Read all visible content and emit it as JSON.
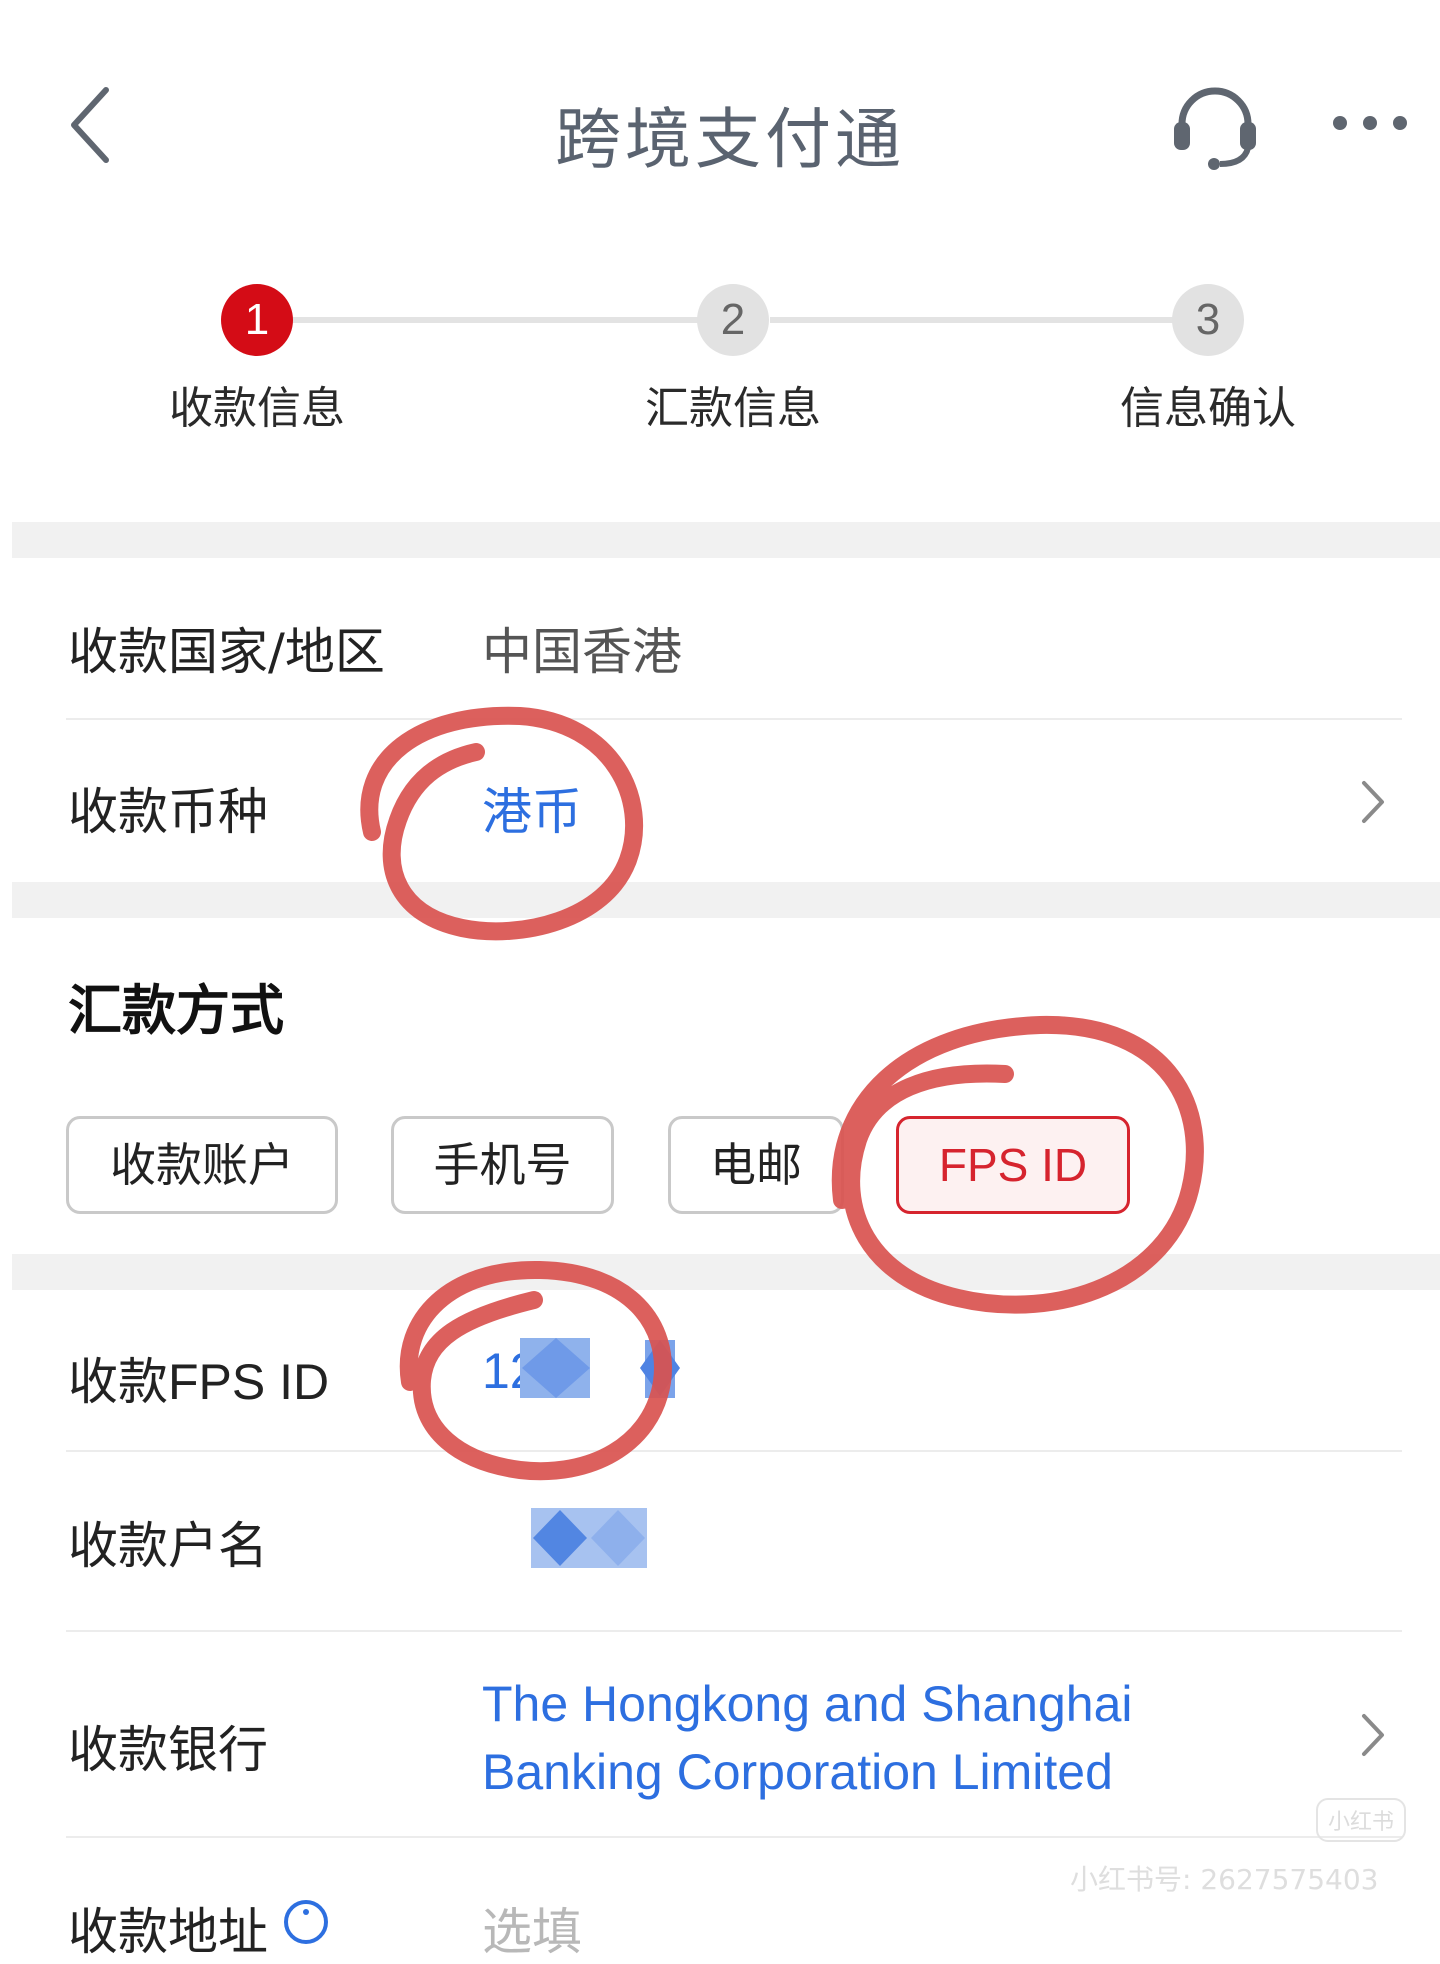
{
  "header": {
    "title": "跨境支付通",
    "back_icon": "chevron-left-icon",
    "support_icon": "headset-icon",
    "more_icon": "more-dots-icon"
  },
  "stepper": {
    "current_step": 1,
    "steps": [
      {
        "number": "1",
        "label": "收款信息"
      },
      {
        "number": "2",
        "label": "汇款信息"
      },
      {
        "number": "3",
        "label": "信息确认"
      }
    ]
  },
  "fields": {
    "country": {
      "label": "收款国家/地区",
      "value": "中国香港"
    },
    "currency": {
      "label": "收款币种",
      "value": "港币"
    }
  },
  "remit_method": {
    "title": "汇款方式",
    "options": [
      "收款账户",
      "手机号",
      "电邮",
      "FPS ID"
    ],
    "selected": "FPS ID"
  },
  "payee": {
    "fps_id": {
      "label": "收款FPS ID",
      "value": "12"
    },
    "name": {
      "label": "收款户名"
    },
    "bank": {
      "label": "收款银行",
      "line1": "The Hongkong and Shanghai",
      "line2": "Banking Corporation Limited"
    },
    "address": {
      "label": "收款地址",
      "placeholder": "选填"
    }
  },
  "watermark": {
    "logo": "小红书",
    "text": "小红书号: 2627575403"
  },
  "colors": {
    "brand_red": "#d40c16",
    "link_blue": "#2d6fe0",
    "annotation_red": "#d9534f"
  }
}
